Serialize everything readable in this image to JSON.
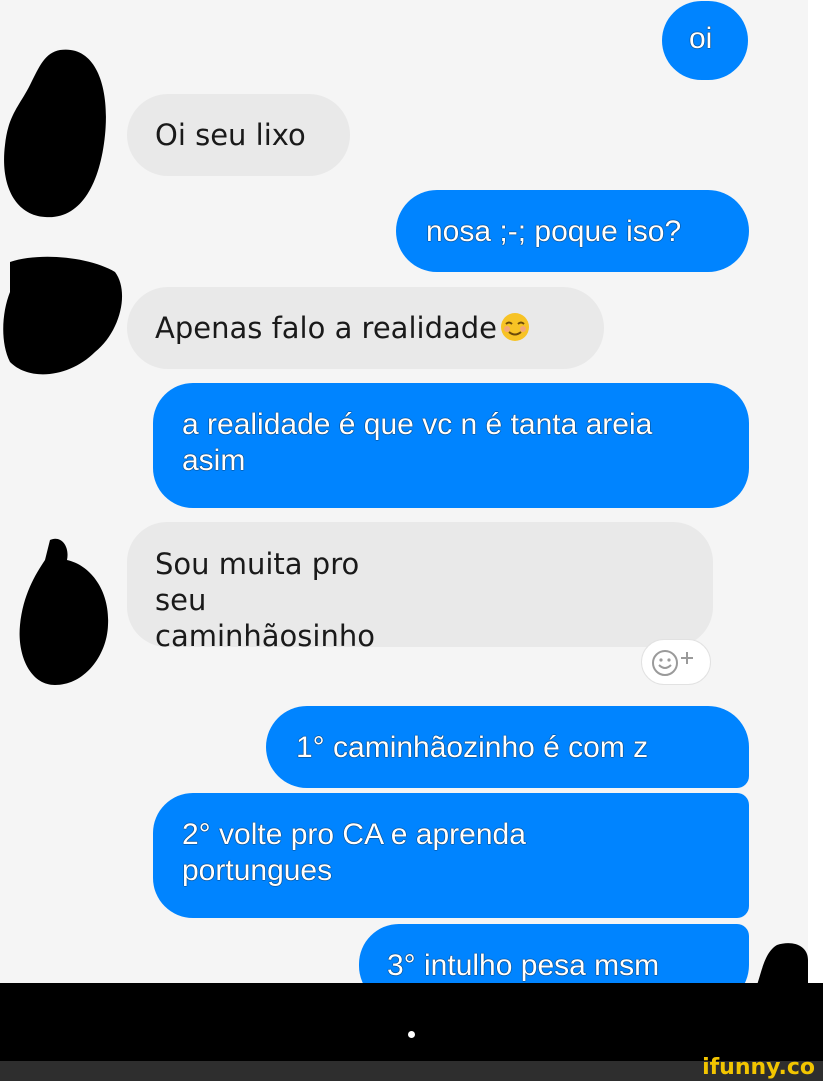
{
  "conversation": {
    "messages": [
      {
        "side": "sent",
        "text": "oi"
      },
      {
        "side": "received",
        "text": "Oi seu lixo"
      },
      {
        "side": "sent",
        "text": "nosa ;-; poque iso?"
      },
      {
        "side": "received",
        "text": "Apenas falo a realidade",
        "emoji": "relieved-face"
      },
      {
        "side": "sent",
        "text": "a realidade é que vc n é tanta areia asim"
      },
      {
        "side": "received",
        "text": "Sou muita pro seu caminhãosinho"
      },
      {
        "side": "sent",
        "text": "1° caminhãozinho é com z"
      },
      {
        "side": "sent",
        "text": "2° volte pro CA e aprenda portungues"
      },
      {
        "side": "sent",
        "text": "3° intulho pesa msm"
      }
    ],
    "reaction_button": {
      "icon": "add-reaction-icon"
    }
  },
  "colors": {
    "sent_bubble": "#0084ff",
    "received_bubble": "#e9e9e9",
    "background": "#f5f5f5"
  },
  "watermark": {
    "text": "ifunny.co"
  }
}
